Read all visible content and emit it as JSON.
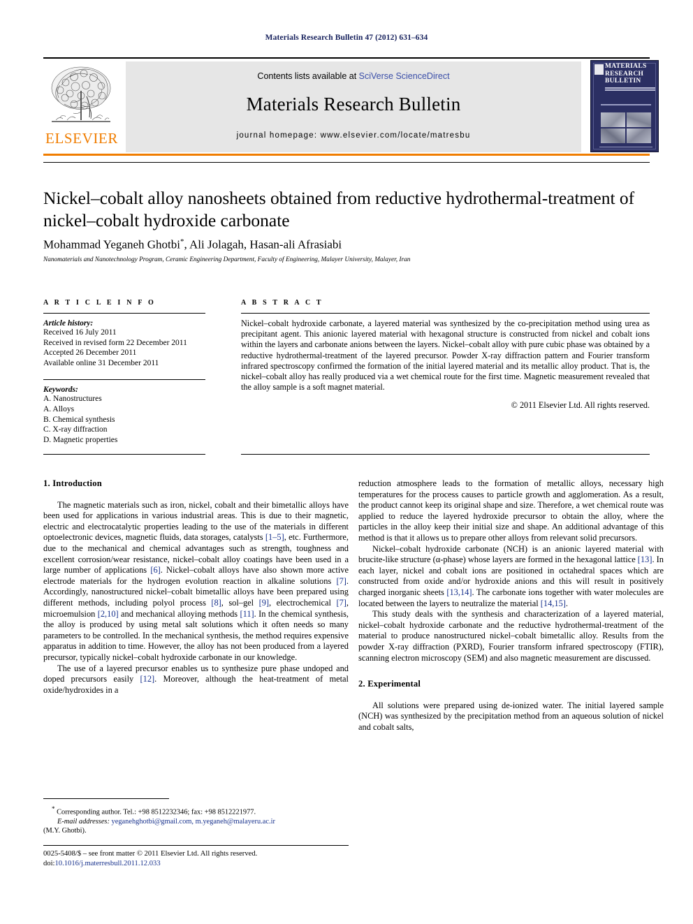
{
  "running_head": "Materials Research Bulletin 47 (2012) 631–634",
  "masthead": {
    "contents_prefix": "Contents lists available at ",
    "sciencedirect": "SciVerse ScienceDirect",
    "journal_name": "Materials Research Bulletin",
    "homepage": "journal homepage: www.elsevier.com/locate/matresbu",
    "publisher_logo_text": "ELSEVIER",
    "cover": {
      "title_line1": "MATERIALS",
      "title_line2": "RESEARCH",
      "title_line3": "BULLETIN"
    }
  },
  "article": {
    "title": "Nickel–cobalt alloy nanosheets obtained from reductive hydrothermal-treatment of nickel–cobalt hydroxide carbonate",
    "authors": "Mohammad Yeganeh Ghotbi *, Ali Jolagah, Hasan-ali Afrasiabi",
    "affiliation": "Nanomaterials and Nanotechnology Program, Ceramic Engineering Department, Faculty of Engineering, Malayer University, Malayer, Iran"
  },
  "article_info": {
    "heading": "A R T I C L E   I N F O",
    "history_label": "Article history:",
    "history": [
      "Received 16 July 2011",
      "Received in revised form 22 December 2011",
      "Accepted 26 December 2011",
      "Available online 31 December 2011"
    ],
    "keywords_label": "Keywords:",
    "keywords": [
      "A. Nanostructures",
      "A. Alloys",
      "B. Chemical synthesis",
      "C. X-ray diffraction",
      "D. Magnetic properties"
    ]
  },
  "abstract": {
    "heading": "A B S T R A C T",
    "text": "Nickel–cobalt hydroxide carbonate, a layered material was synthesized by the co-precipitation method using urea as precipitant agent. This anionic layered material with hexagonal structure is constructed from nickel and cobalt ions within the layers and carbonate anions between the layers. Nickel–cobalt alloy with pure cubic phase was obtained by a reductive hydrothermal-treatment of the layered precursor. Powder X-ray diffraction pattern and Fourier transform infrared spectroscopy confirmed the formation of the initial layered material and its metallic alloy product. That is, the nickel–cobalt alloy has really produced via a wet chemical route for the first time. Magnetic measurement revealed that the alloy sample is a soft magnet material.",
    "copyright": "© 2011 Elsevier Ltd. All rights reserved."
  },
  "body": {
    "section1_heading": "1.  Introduction",
    "section2_heading": "2.  Experimental",
    "left_para1_a": "The magnetic materials such as iron, nickel, cobalt and their bimetallic alloys have been used for applications in various industrial areas. This is due to their magnetic, electric and electrocatalytic properties leading to the use of the materials in different optoelectronic devices, magnetic fluids, data storages, catalysts ",
    "left_para1_ref1": "[1–5]",
    "left_para1_b": ", etc. Furthermore, due to the mechanical and chemical advantages such as strength, toughness and excellent corrosion/wear resistance, nickel–cobalt alloy coatings have been used in a large number of applications ",
    "left_para1_ref2": "[6]",
    "left_para1_c": ". Nickel–cobalt alloys have also shown more active electrode materials for the hydrogen evolution reaction in alkaline solutions ",
    "left_para1_ref3": "[7]",
    "left_para1_d": ". Accordingly, nanostructured nickel–cobalt bimetallic alloys have been prepared using different methods, including polyol process ",
    "left_para1_ref4": "[8]",
    "left_para1_e": ", sol–gel ",
    "left_para1_ref5": "[9]",
    "left_para1_f": ", electrochemical ",
    "left_para1_ref6": "[7]",
    "left_para1_g": ", microemulsion ",
    "left_para1_ref7": "[2,10]",
    "left_para1_h": " and mechanical alloying methods ",
    "left_para1_ref8": "[11]",
    "left_para1_i": ". In the chemical synthesis, the alloy is produced by using metal salt solutions which it often needs so many parameters to be controlled. In the mechanical synthesis, the method requires expensive apparatus in addition to time. However, the alloy has not been produced from a layered precursor, typically nickel–cobalt hydroxide carbonate in our knowledge.",
    "left_para2_a": "The use of a layered precursor enables us to synthesize pure phase undoped and doped precursors easily ",
    "left_para2_ref1": "[12]",
    "left_para2_b": ". Moreover, although the heat-treatment of metal oxide/hydroxides in a",
    "right_para1": "reduction atmosphere leads to the formation of metallic alloys, necessary high temperatures for the process causes to particle growth and agglomeration. As a result, the product cannot keep its original shape and size. Therefore, a wet chemical route was applied to reduce the layered hydroxide precursor to obtain the alloy, where the particles in the alloy keep their initial size and shape. An additional advantage of this method is that it allows us to prepare other alloys from relevant solid precursors.",
    "right_para2_a": "Nickel–cobalt hydroxide carbonate (NCH) is an anionic layered material with brucite-like structure (α-phase) whose layers are formed in the hexagonal lattice ",
    "right_para2_ref1": "[13]",
    "right_para2_b": ". In each layer, nickel and cobalt ions are positioned in octahedral spaces which are constructed from oxide and/or hydroxide anions and this will result in positively charged inorganic sheets ",
    "right_para2_ref2": "[13,14]",
    "right_para2_c": ". The carbonate ions together with water molecules are located between the layers to neutralize the material ",
    "right_para2_ref3": "[14,15]",
    "right_para2_d": ".",
    "right_para3": "This study deals with the synthesis and characterization of a layered material, nickel–cobalt hydroxide carbonate and the reductive hydrothermal-treatment of the material to produce nanostructured nickel–cobalt bimetallic alloy. Results from the powder X-ray diffraction (PXRD), Fourier transform infrared spectroscopy (FTIR), scanning electron microscopy (SEM) and also magnetic measurement are discussed.",
    "right_para4": "All solutions were prepared using de-ionized water. The initial layered sample (NCH) was synthesized by the precipitation method from an aqueous solution of nickel and cobalt salts,"
  },
  "footnote": {
    "corresponding": "* Corresponding author. Tel.: +98 8512232346; fax: +98 8512221977.",
    "email_label": "E-mail addresses:",
    "emails": "yeganehghotbi@gmail.com, m.yeganeh@malayeru.ac.ir",
    "author_short": "(M.Y. Ghotbi)."
  },
  "imprint": {
    "line1": "0025-5408/$ – see front matter © 2011 Elsevier Ltd. All rights reserved.",
    "doi_label": "doi:",
    "doi": "10.1016/j.materresbull.2011.12.033"
  },
  "colors": {
    "link_blue": "#3a4ea8",
    "reference_blue": "#16308c",
    "elsevier_orange": "#f07d00",
    "running_head_navy": "#16205c",
    "cover_navy": "#2b2f63"
  }
}
